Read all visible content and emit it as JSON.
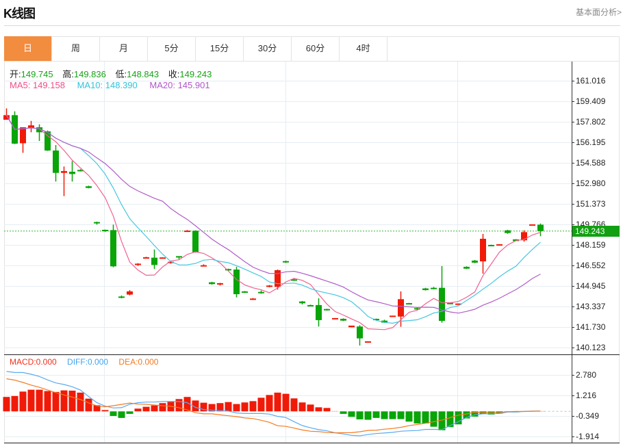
{
  "header": {
    "title": "K线图",
    "link": "基本面分析>"
  },
  "tabs": [
    {
      "label": "日",
      "active": true
    },
    {
      "label": "周"
    },
    {
      "label": "月"
    },
    {
      "label": "5分"
    },
    {
      "label": "15分"
    },
    {
      "label": "30分"
    },
    {
      "label": "60分"
    },
    {
      "label": "4时"
    }
  ],
  "quote": {
    "open_label": "开:",
    "open": "149.745",
    "high_label": "高:",
    "high": "149.836",
    "low_label": "低:",
    "low": "148.843",
    "close_label": "收:",
    "close": "149.243"
  },
  "ma": {
    "ma5": "MA5: 149.158",
    "ma10": "MA10: 148.390",
    "ma20": "MA20: 145.901"
  },
  "macd_legend": {
    "macd": "MACD:0.000",
    "diff": "DIFF:0.000",
    "dea": "DEA:0.000"
  },
  "colors": {
    "up": "#f01a08",
    "down": "#08a408",
    "ma5": "#f0608e",
    "ma10": "#45c6e0",
    "ma20": "#b05cc8",
    "diff": "#5aaaf0",
    "dea": "#f57a20",
    "accent": "#f28c3f"
  },
  "chart_data": {
    "type": "candlestick",
    "current_price": "149.243",
    "price_axis": {
      "ticks": [
        "161.016",
        "159.409",
        "157.802",
        "156.195",
        "154.588",
        "152.980",
        "151.373",
        "149.766",
        "148.159",
        "146.552",
        "144.945",
        "143.337",
        "141.730",
        "140.123"
      ],
      "range": [
        140.123,
        161.016
      ]
    },
    "macd_axis": {
      "ticks": [
        "2.780",
        "1.216",
        "-0.349",
        "-1.914"
      ],
      "range": [
        -1.914,
        2.78
      ]
    },
    "ohlc": [
      [
        157.96,
        158.85,
        157.96,
        158.32
      ],
      [
        158.32,
        158.62,
        156.05,
        156.09
      ],
      [
        156.12,
        157.37,
        155.37,
        157.37
      ],
      [
        157.34,
        157.87,
        156.98,
        157.52
      ],
      [
        157.37,
        157.6,
        156.3,
        156.98
      ],
      [
        157.05,
        157.12,
        155.52,
        155.55
      ],
      [
        155.55,
        155.98,
        153.12,
        153.8
      ],
      [
        153.8,
        154.3,
        151.98,
        153.94
      ],
      [
        153.89,
        154.73,
        153.12,
        153.71
      ],
      [
        154.03,
        154.09,
        153.91,
        153.94
      ],
      [
        152.75,
        152.8,
        152.59,
        152.62
      ],
      [
        149.95,
        149.98,
        149.75,
        149.84
      ],
      [
        149.34,
        149.36,
        149.19,
        149.23
      ],
      [
        149.32,
        149.75,
        146.41,
        146.48
      ],
      [
        144.12,
        144.2,
        143.98,
        144.02
      ],
      [
        144.27,
        144.62,
        144.21,
        144.52
      ],
      [
        146.59,
        146.73,
        146.52,
        146.69
      ],
      [
        147.12,
        147.23,
        147.09,
        147.19
      ],
      [
        147.16,
        147.8,
        146.27,
        146.59
      ],
      [
        147.11,
        147.18,
        147.11,
        147.18
      ],
      [
        146.77,
        146.91,
        146.69,
        146.84
      ],
      [
        147.28,
        147.28,
        147.05,
        147.19
      ],
      [
        149.21,
        149.32,
        149.21,
        149.28
      ],
      [
        149.27,
        149.3,
        147.55,
        147.59
      ],
      [
        146.5,
        146.64,
        146.5,
        146.57
      ],
      [
        145.23,
        145.27,
        145.05,
        145.09
      ],
      [
        145.07,
        145.19,
        144.98,
        145.16
      ],
      [
        146.27,
        146.3,
        146.12,
        146.16
      ],
      [
        146.23,
        146.45,
        144.05,
        144.3
      ],
      [
        144.52,
        144.55,
        144.4,
        144.43
      ],
      [
        143.86,
        144.0,
        143.86,
        143.96
      ],
      [
        144.48,
        144.59,
        144.34,
        144.37
      ],
      [
        144.87,
        145.02,
        144.84,
        144.98
      ],
      [
        144.87,
        146.23,
        144.66,
        146.18
      ],
      [
        146.89,
        146.93,
        146.75,
        146.8
      ],
      [
        145.46,
        145.55,
        145.34,
        145.37
      ],
      [
        143.73,
        143.77,
        143.5,
        143.59
      ],
      [
        143.45,
        143.48,
        143.36,
        143.36
      ],
      [
        143.45,
        143.98,
        141.77,
        142.27
      ],
      [
        143.14,
        143.16,
        143.02,
        143.05
      ],
      [
        142.34,
        142.43,
        142.34,
        142.43
      ],
      [
        142.37,
        142.41,
        142.2,
        142.23
      ],
      [
        141.71,
        141.84,
        141.71,
        141.84
      ],
      [
        141.77,
        141.87,
        140.28,
        140.84
      ],
      [
        140.55,
        140.61,
        140.55,
        140.61
      ],
      [
        142.37,
        142.39,
        142.25,
        142.27
      ],
      [
        142.23,
        142.3,
        142.05,
        142.07
      ],
      [
        142.53,
        142.62,
        142.53,
        142.62
      ],
      [
        142.55,
        144.52,
        141.75,
        143.91
      ],
      [
        143.6,
        143.62,
        143.5,
        143.5
      ],
      [
        143.21,
        143.27,
        143.05,
        143.11
      ],
      [
        144.75,
        144.8,
        144.59,
        144.62
      ],
      [
        144.8,
        144.87,
        144.68,
        144.71
      ],
      [
        144.8,
        146.5,
        142.07,
        142.21
      ],
      [
        143.62,
        143.64,
        143.52,
        143.52
      ],
      [
        143.5,
        143.57,
        143.5,
        143.57
      ],
      [
        146.44,
        146.48,
        146.27,
        146.3
      ],
      [
        146.93,
        146.98,
        146.73,
        146.77
      ],
      [
        146.87,
        149.02,
        145.91,
        148.64
      ],
      [
        148.16,
        148.18,
        148.05,
        148.05
      ],
      [
        148.11,
        148.21,
        148.11,
        148.21
      ],
      [
        149.3,
        149.34,
        149.03,
        149.09
      ],
      [
        148.59,
        148.61,
        148.46,
        148.46
      ],
      [
        148.52,
        149.3,
        148.41,
        149.16
      ],
      [
        149.69,
        149.77,
        149.69,
        149.77
      ],
      [
        149.745,
        149.836,
        148.843,
        149.243
      ]
    ],
    "macd_hist": [
      1.1,
      1.17,
      1.51,
      1.65,
      1.65,
      1.55,
      1.48,
      1.6,
      1.58,
      1.43,
      0.97,
      0.47,
      0.1,
      -0.35,
      -0.5,
      -0.19,
      0.21,
      0.35,
      0.45,
      0.63,
      0.73,
      0.94,
      1.1,
      0.83,
      0.66,
      0.56,
      0.63,
      0.71,
      0.56,
      0.68,
      0.78,
      1.04,
      1.25,
      1.43,
      1.34,
      0.99,
      0.68,
      0.52,
      0.31,
      0.26,
      0.01,
      -0.19,
      -0.42,
      -0.61,
      -0.64,
      -0.5,
      -0.59,
      -0.59,
      -0.59,
      -0.78,
      -0.92,
      -0.92,
      -1.17,
      -1.44,
      -1.2,
      -0.99,
      -0.54,
      -0.4,
      -0.21,
      -0.24,
      -0.17,
      -0.05,
      -0.07,
      0.02,
      0.02,
      0.0
    ],
    "diff": [
      3.04,
      2.97,
      2.96,
      2.83,
      2.66,
      2.4,
      2.17,
      2.05,
      1.88,
      1.62,
      1.13,
      0.66,
      0.4,
      0.26,
      0.28,
      0.54,
      0.66,
      0.71,
      0.71,
      0.75,
      0.75,
      0.75,
      0.66,
      0.31,
      0.14,
      0.09,
      0.05,
      0.02,
      -0.12,
      -0.16,
      -0.16,
      -0.16,
      -0.21,
      -0.38,
      -0.47,
      -0.78,
      -1.08,
      -1.25,
      -1.39,
      -1.48,
      -1.63,
      -1.72,
      -1.83,
      -1.86,
      -1.77,
      -1.69,
      -1.65,
      -1.6,
      -1.51,
      -1.48,
      -1.46,
      -1.37,
      -1.37,
      -1.39,
      -1.08,
      -0.78,
      -0.47,
      -0.26,
      -0.19,
      -0.17,
      -0.16,
      -0.05,
      -0.04,
      0.0,
      0.02,
      0.02
    ]
  }
}
